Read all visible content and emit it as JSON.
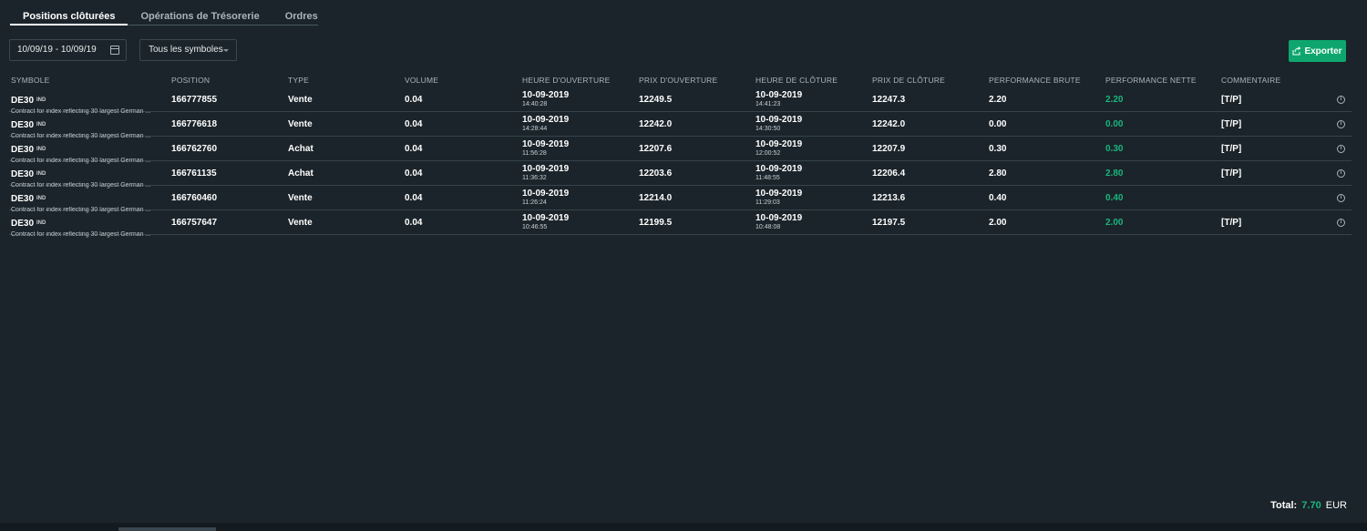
{
  "tabs": [
    {
      "label": "Positions clôturées",
      "active": true
    },
    {
      "label": "Opérations de Trésorerie",
      "active": false
    },
    {
      "label": "Ordres",
      "active": false
    }
  ],
  "filters": {
    "date_range": "10/09/19 - 10/09/19",
    "symbol": "Tous les symboles"
  },
  "export_label": "Exporter",
  "columns": {
    "symbol": "SYMBOLE",
    "position": "POSITION",
    "type": "TYPE",
    "volume": "VOLUME",
    "open_time": "HEURE D'OUVERTURE",
    "open_price": "PRIX D'OUVERTURE",
    "close_time": "HEURE DE CLÔTURE",
    "close_price": "PRIX DE CLÔTURE",
    "gross": "PERFORMANCE BRUTE",
    "net": "PERFORMANCE NETTE",
    "comment": "COMMENTAIRE"
  },
  "rows": [
    {
      "symbol": "DE30",
      "tag": "IND",
      "desc": "Contract for index reflecting 30 largest German ...",
      "position": "166777855",
      "type": "Vente",
      "volume": "0.04",
      "open_date": "10-09-2019",
      "open_time": "14:40:28",
      "open_price": "12249.5",
      "close_date": "10-09-2019",
      "close_time": "14:41:23",
      "close_price": "12247.3",
      "gross": "2.20",
      "net": "2.20",
      "comment": "[T/P]"
    },
    {
      "symbol": "DE30",
      "tag": "IND",
      "desc": "Contract for index reflecting 30 largest German ...",
      "position": "166776618",
      "type": "Vente",
      "volume": "0.04",
      "open_date": "10-09-2019",
      "open_time": "14:28:44",
      "open_price": "12242.0",
      "close_date": "10-09-2019",
      "close_time": "14:30:50",
      "close_price": "12242.0",
      "gross": "0.00",
      "net": "0.00",
      "comment": "[T/P]"
    },
    {
      "symbol": "DE30",
      "tag": "IND",
      "desc": "Contract for index reflecting 30 largest German ...",
      "position": "166762760",
      "type": "Achat",
      "volume": "0.04",
      "open_date": "10-09-2019",
      "open_time": "11:56:28",
      "open_price": "12207.6",
      "close_date": "10-09-2019",
      "close_time": "12:00:52",
      "close_price": "12207.9",
      "gross": "0.30",
      "net": "0.30",
      "comment": "[T/P]"
    },
    {
      "symbol": "DE30",
      "tag": "IND",
      "desc": "Contract for index reflecting 30 largest German ...",
      "position": "166761135",
      "type": "Achat",
      "volume": "0.04",
      "open_date": "10-09-2019",
      "open_time": "11:36:32",
      "open_price": "12203.6",
      "close_date": "10-09-2019",
      "close_time": "11:48:55",
      "close_price": "12206.4",
      "gross": "2.80",
      "net": "2.80",
      "comment": "[T/P]"
    },
    {
      "symbol": "DE30",
      "tag": "IND",
      "desc": "Contract for index reflecting 30 largest German ...",
      "position": "166760460",
      "type": "Vente",
      "volume": "0.04",
      "open_date": "10-09-2019",
      "open_time": "11:26:24",
      "open_price": "12214.0",
      "close_date": "10-09-2019",
      "close_time": "11:29:03",
      "close_price": "12213.6",
      "gross": "0.40",
      "net": "0.40",
      "comment": ""
    },
    {
      "symbol": "DE30",
      "tag": "IND",
      "desc": "Contract for index reflecting 30 largest German ...",
      "position": "166757647",
      "type": "Vente",
      "volume": "0.04",
      "open_date": "10-09-2019",
      "open_time": "10:46:55",
      "open_price": "12199.5",
      "close_date": "10-09-2019",
      "close_time": "10:48:08",
      "close_price": "12197.5",
      "gross": "2.00",
      "net": "2.00",
      "comment": "[T/P]"
    }
  ],
  "total": {
    "label": "Total:",
    "value": "7.70",
    "currency": "EUR"
  },
  "colors": {
    "accent_green": "#19b57d",
    "button_green": "#0ea66e",
    "background": "#1b242a"
  }
}
